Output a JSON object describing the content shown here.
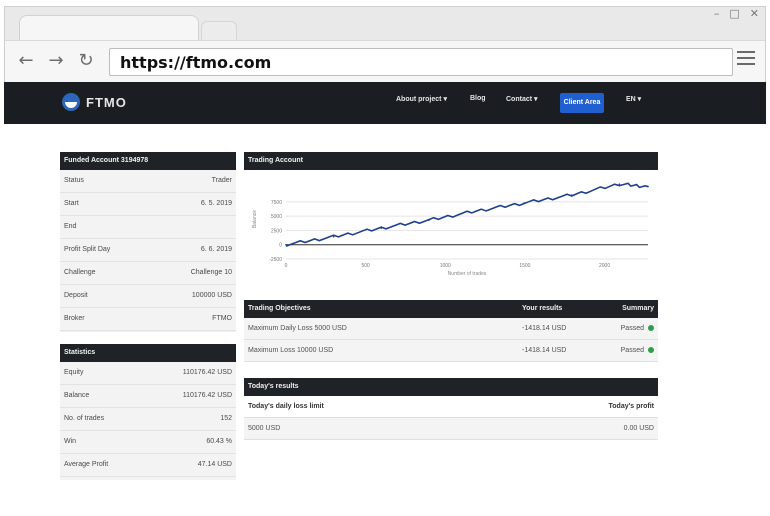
{
  "browser": {
    "url": "https://ftmo.com",
    "window_buttons": [
      "–",
      "□",
      "✕"
    ]
  },
  "site": {
    "brand": "FTMO",
    "nav": [
      "About project ▾",
      "Blog",
      "Contact ▾"
    ],
    "cta": "Client Area",
    "lang": "EN ▾"
  },
  "account_panel": {
    "title": "Funded Account 3194978",
    "rows": [
      {
        "k": "Status",
        "v": "Trader"
      },
      {
        "k": "Start",
        "v": "6. 5. 2019"
      },
      {
        "k": "End",
        "v": ""
      },
      {
        "k": "Profit Split Day",
        "v": "6. 6. 2019"
      },
      {
        "k": "Challenge",
        "v": "Challenge 10"
      },
      {
        "k": "Deposit",
        "v": "100000 USD"
      },
      {
        "k": "Broker",
        "v": "FTMO"
      }
    ]
  },
  "statistics_panel": {
    "title": "Statistics",
    "rows": [
      {
        "k": "Equity",
        "v": "110176.42 USD"
      },
      {
        "k": "Balance",
        "v": "110176.42 USD"
      },
      {
        "k": "No. of trades",
        "v": "152"
      },
      {
        "k": "Win",
        "v": "60.43 %"
      },
      {
        "k": "Average Profit",
        "v": "47.14 USD"
      }
    ]
  },
  "trading_account": {
    "title": "Trading Account",
    "chart_data": {
      "type": "line",
      "title": "",
      "xlabel": "Number of trades",
      "ylabel": "Balance",
      "x": [
        0,
        20,
        40,
        60,
        80,
        100,
        120,
        140,
        152
      ],
      "y": [
        0,
        1400,
        2900,
        4300,
        5900,
        7300,
        8700,
        10600,
        10176
      ],
      "yticks": [
        "7500",
        "5000",
        "2500",
        "0",
        "-2500"
      ],
      "xticks": [
        "0",
        "500",
        "1000",
        "1500",
        "2000"
      ],
      "color": "#1f3f8c"
    }
  },
  "objectives": {
    "title": "Trading Objectives",
    "col_results": "Your results",
    "col_summary": "Summary",
    "rows": [
      {
        "name": "Maximum Daily Loss 5000 USD",
        "result": "-1418.14 USD",
        "summary": "Passed",
        "dot": "#2e9e4c"
      },
      {
        "name": "Maximum Loss 10000 USD",
        "result": "-1418.14 USD",
        "summary": "Passed",
        "dot": "#2e9e4c"
      }
    ]
  },
  "today": {
    "title": "Today's results",
    "col_left": "Today's daily loss limit",
    "col_right": "Today's profit",
    "row": {
      "left": "5000 USD",
      "right": "0.00 USD"
    }
  }
}
